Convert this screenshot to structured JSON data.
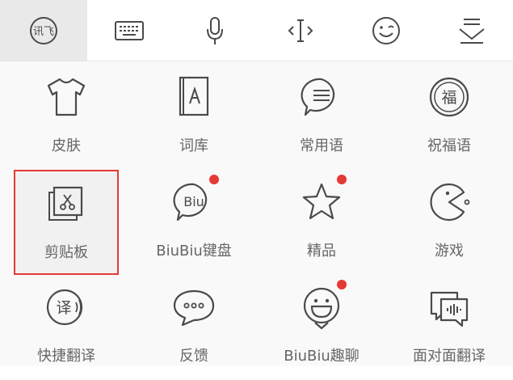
{
  "toolbar": {
    "items": [
      {
        "icon": "ifly-logo-icon",
        "logo_text": "讯飞"
      },
      {
        "icon": "keyboard-icon"
      },
      {
        "icon": "microphone-icon"
      },
      {
        "icon": "cursor-move-icon"
      },
      {
        "icon": "emoji-icon"
      },
      {
        "icon": "hide-keyboard-icon"
      }
    ]
  },
  "grid": {
    "items": [
      {
        "label": "皮肤",
        "icon": "tshirt-icon",
        "badge": false
      },
      {
        "label": "词库",
        "icon": "dictionary-icon",
        "badge": false
      },
      {
        "label": "常用语",
        "icon": "phrases-icon",
        "badge": false
      },
      {
        "label": "祝福语",
        "icon": "blessing-icon",
        "badge": false
      },
      {
        "label": "剪贴板",
        "icon": "clipboard-icon",
        "badge": false,
        "selected": true
      },
      {
        "label": "BiuBiu键盘",
        "icon": "biubiu-keyboard-icon",
        "badge": true,
        "icon_text": "Biu"
      },
      {
        "label": "精品",
        "icon": "star-icon",
        "badge": true
      },
      {
        "label": "游戏",
        "icon": "game-icon",
        "badge": false
      },
      {
        "label": "快捷翻译",
        "icon": "quick-translate-icon",
        "badge": false,
        "icon_text": "译"
      },
      {
        "label": "反馈",
        "icon": "feedback-icon",
        "badge": false
      },
      {
        "label": "BiuBiu趣聊",
        "icon": "biubiu-chat-icon",
        "badge": true
      },
      {
        "label": "面对面翻译",
        "icon": "face-to-face-translate-icon",
        "badge": false
      }
    ]
  },
  "colors": {
    "icon_stroke": "#4a4a4a",
    "label": "#666666",
    "badge": "#e53935",
    "selection_border": "#e53935",
    "active_tab_bg": "#e9e9e9"
  }
}
